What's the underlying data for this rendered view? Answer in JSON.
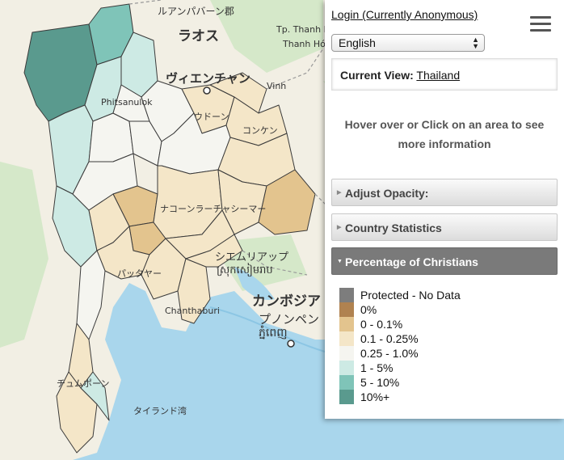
{
  "map": {
    "labels": [
      {
        "text": "ルアンパバーン郡"
      },
      {
        "text": "ラオス"
      },
      {
        "text": "ヴィエンチャン"
      },
      {
        "text": "ウドーン"
      },
      {
        "text": "コンケン"
      },
      {
        "text": "ナコーンラーチャシーマー"
      },
      {
        "text": "シエムリアップ"
      },
      {
        "text": "ស្រុកសៀមរាប"
      },
      {
        "text": "カンボジア"
      },
      {
        "text": "プノンペン"
      },
      {
        "text": "ភ្នំពេញ"
      },
      {
        "text": "タイランド湾"
      },
      {
        "text": "パッタヤー"
      },
      {
        "text": "チュムポーン"
      },
      {
        "text": "Tp. Thanh Hóa"
      },
      {
        "text": "Thanh Hóa"
      },
      {
        "text": "Vinh"
      },
      {
        "text": "Phitsanulok"
      },
      {
        "text": "Chanthaburi"
      }
    ],
    "colors": {
      "water": "#a9d6ec",
      "land": "#f2efe4",
      "forest": "#d5e8c9",
      "border": "#3a3a3a"
    }
  },
  "panel": {
    "login": "Login (Currently Anonymous)",
    "language": "English",
    "current_view_label": "Current View:",
    "current_view_value": "Thailand",
    "hover_info": "Hover over or Click on an area to see more information",
    "accordions": [
      {
        "label": "Adjust Opacity:",
        "active": false
      },
      {
        "label": "Country Statistics",
        "active": false
      },
      {
        "label": "Percentage of Christians",
        "active": true
      }
    ],
    "legend": [
      {
        "label": "Protected - No Data",
        "color": "#7d7d7d"
      },
      {
        "label": "0%",
        "color": "#b08250"
      },
      {
        "label": "0 - 0.1%",
        "color": "#e3c48e"
      },
      {
        "label": "0.1 - 0.25%",
        "color": "#f4e6c8"
      },
      {
        "label": "0.25 - 1.0%",
        "color": "#f5f5f0"
      },
      {
        "label": "1 - 5%",
        "color": "#cdeae4"
      },
      {
        "label": "5 - 10%",
        "color": "#7fc4b8"
      },
      {
        "label": "10%+",
        "color": "#5a9a8e"
      }
    ]
  }
}
